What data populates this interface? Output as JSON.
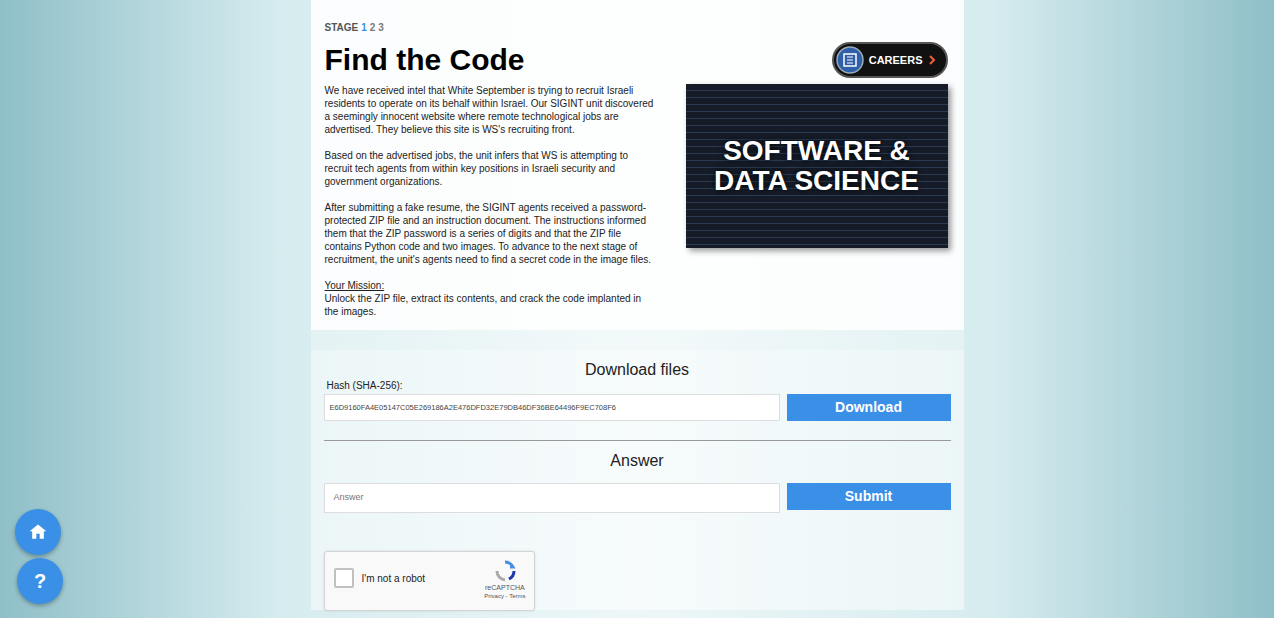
{
  "stage": {
    "label": "STAGE",
    "steps": [
      {
        "label": "1",
        "selected": true
      },
      {
        "label": "2",
        "selected": false
      },
      {
        "label": "3",
        "selected": false
      }
    ]
  },
  "title": "Find the Code",
  "careers_badge": {
    "label": "CAREERS"
  },
  "intro": [
    "We have received intel that White September is trying to recruit Israeli residents to operate on its behalf within Israel. Our SIGINT unit discovered a seemingly innocent website where remote technological jobs are advertised. They believe this site is WS's recruiting front.",
    "Based on the advertised jobs, the unit infers that WS is attempting to recruit tech agents from within key positions in Israeli security and government organizations.",
    "After submitting a fake resume, the SIGINT agents received a password-protected ZIP file and an instruction document. The instructions informed them that the ZIP password is a series of digits and that the ZIP file contains Python code and two images. To advance to the next stage of recruitment, the unit's agents need to find a secret code in the image files."
  ],
  "mission": {
    "heading": "Your Mission:",
    "text": "Unlock the ZIP file, extract its contents, and crack the code implanted in the images."
  },
  "banner": {
    "title_lines": [
      "SOFTWARE &",
      "DATA SCIENCE"
    ]
  },
  "download": {
    "heading": "Download files",
    "hash_label": "Hash (SHA-256):",
    "hash": "E6D9160FA4E05147C05E269186A2E476DFD32E79DB46DF36BE64496F9EC708F6",
    "button": "Download"
  },
  "answer": {
    "heading": "Answer",
    "placeholder": "Answer",
    "button": "Submit"
  },
  "captcha": {
    "label": "I'm not a robot",
    "checked": false,
    "brand": "reCAPTCHA",
    "links": "Privacy - Terms"
  },
  "side_buttons": [
    {
      "kind": "home",
      "label": ""
    },
    {
      "kind": "help",
      "label": "?"
    }
  ]
}
